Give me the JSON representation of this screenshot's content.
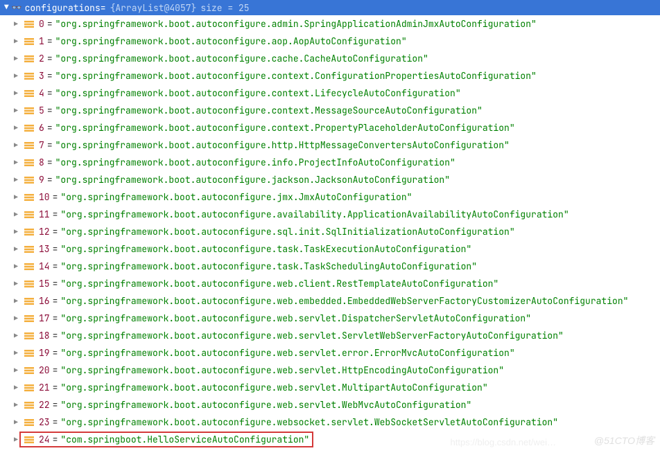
{
  "header": {
    "var_name": "configurations",
    "equals": " = ",
    "type": "{ArrayList@4057}",
    "size_label": "  size = 25"
  },
  "entries": [
    {
      "index": "0",
      "value": "\"org.springframework.boot.autoconfigure.admin.SpringApplicationAdminJmxAutoConfiguration\""
    },
    {
      "index": "1",
      "value": "\"org.springframework.boot.autoconfigure.aop.AopAutoConfiguration\""
    },
    {
      "index": "2",
      "value": "\"org.springframework.boot.autoconfigure.cache.CacheAutoConfiguration\""
    },
    {
      "index": "3",
      "value": "\"org.springframework.boot.autoconfigure.context.ConfigurationPropertiesAutoConfiguration\""
    },
    {
      "index": "4",
      "value": "\"org.springframework.boot.autoconfigure.context.LifecycleAutoConfiguration\""
    },
    {
      "index": "5",
      "value": "\"org.springframework.boot.autoconfigure.context.MessageSourceAutoConfiguration\""
    },
    {
      "index": "6",
      "value": "\"org.springframework.boot.autoconfigure.context.PropertyPlaceholderAutoConfiguration\""
    },
    {
      "index": "7",
      "value": "\"org.springframework.boot.autoconfigure.http.HttpMessageConvertersAutoConfiguration\""
    },
    {
      "index": "8",
      "value": "\"org.springframework.boot.autoconfigure.info.ProjectInfoAutoConfiguration\""
    },
    {
      "index": "9",
      "value": "\"org.springframework.boot.autoconfigure.jackson.JacksonAutoConfiguration\""
    },
    {
      "index": "10",
      "value": "\"org.springframework.boot.autoconfigure.jmx.JmxAutoConfiguration\""
    },
    {
      "index": "11",
      "value": "\"org.springframework.boot.autoconfigure.availability.ApplicationAvailabilityAutoConfiguration\""
    },
    {
      "index": "12",
      "value": "\"org.springframework.boot.autoconfigure.sql.init.SqlInitializationAutoConfiguration\""
    },
    {
      "index": "13",
      "value": "\"org.springframework.boot.autoconfigure.task.TaskExecutionAutoConfiguration\""
    },
    {
      "index": "14",
      "value": "\"org.springframework.boot.autoconfigure.task.TaskSchedulingAutoConfiguration\""
    },
    {
      "index": "15",
      "value": "\"org.springframework.boot.autoconfigure.web.client.RestTemplateAutoConfiguration\""
    },
    {
      "index": "16",
      "value": "\"org.springframework.boot.autoconfigure.web.embedded.EmbeddedWebServerFactoryCustomizerAutoConfiguration\""
    },
    {
      "index": "17",
      "value": "\"org.springframework.boot.autoconfigure.web.servlet.DispatcherServletAutoConfiguration\""
    },
    {
      "index": "18",
      "value": "\"org.springframework.boot.autoconfigure.web.servlet.ServletWebServerFactoryAutoConfiguration\""
    },
    {
      "index": "19",
      "value": "\"org.springframework.boot.autoconfigure.web.servlet.error.ErrorMvcAutoConfiguration\""
    },
    {
      "index": "20",
      "value": "\"org.springframework.boot.autoconfigure.web.servlet.HttpEncodingAutoConfiguration\""
    },
    {
      "index": "21",
      "value": "\"org.springframework.boot.autoconfigure.web.servlet.MultipartAutoConfiguration\""
    },
    {
      "index": "22",
      "value": "\"org.springframework.boot.autoconfigure.web.servlet.WebMvcAutoConfiguration\""
    },
    {
      "index": "23",
      "value": "\"org.springframework.boot.autoconfigure.websocket.servlet.WebSocketServletAutoConfiguration\""
    },
    {
      "index": "24",
      "value": "\"com.springboot.HelloServiceAutoConfiguration\"",
      "highlighted": true
    }
  ],
  "watermark": "@51CTO博客",
  "watermark2": "https://blog.csdn.net/wei…"
}
